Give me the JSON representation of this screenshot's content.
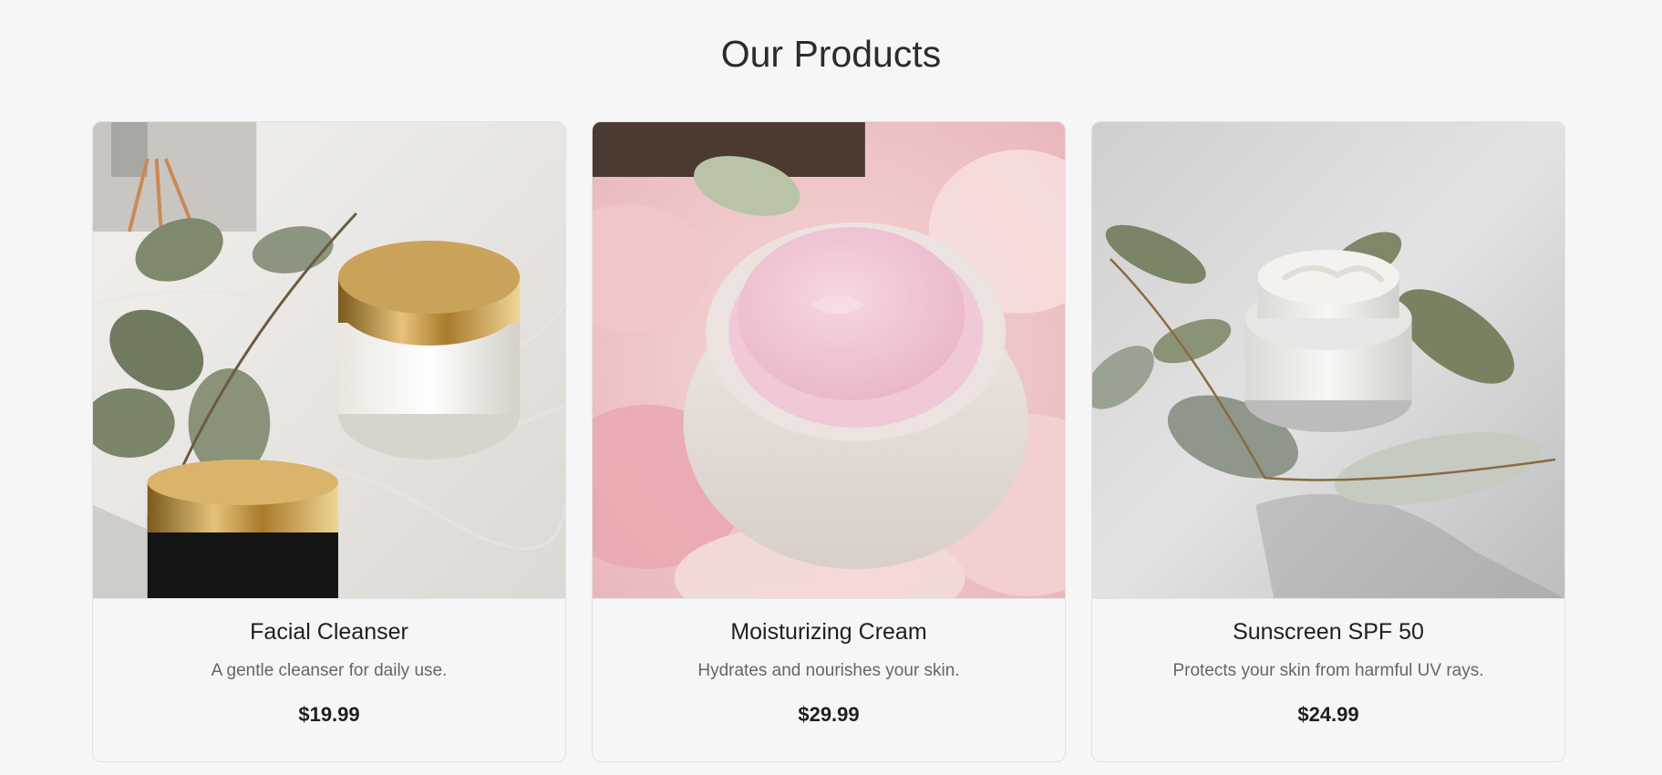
{
  "section": {
    "title": "Our Products"
  },
  "products": [
    {
      "name": "Facial Cleanser",
      "description": "A gentle cleanser for daily use.",
      "price": "$19.99",
      "image": "cream-jars-on-towel-image"
    },
    {
      "name": "Moisturizing Cream",
      "description": "Hydrates and nourishes your skin.",
      "price": "$29.99",
      "image": "pink-cream-jar-rose-petals-image"
    },
    {
      "name": "Sunscreen SPF 50",
      "description": "Protects your skin from harmful UV rays.",
      "price": "$24.99",
      "image": "white-cream-jar-leaves-image"
    }
  ],
  "colors": {
    "background": "#f6f6f6",
    "text": "#1f1f1f",
    "muted_text": "#666666",
    "card_border": "#e1e1e1"
  }
}
